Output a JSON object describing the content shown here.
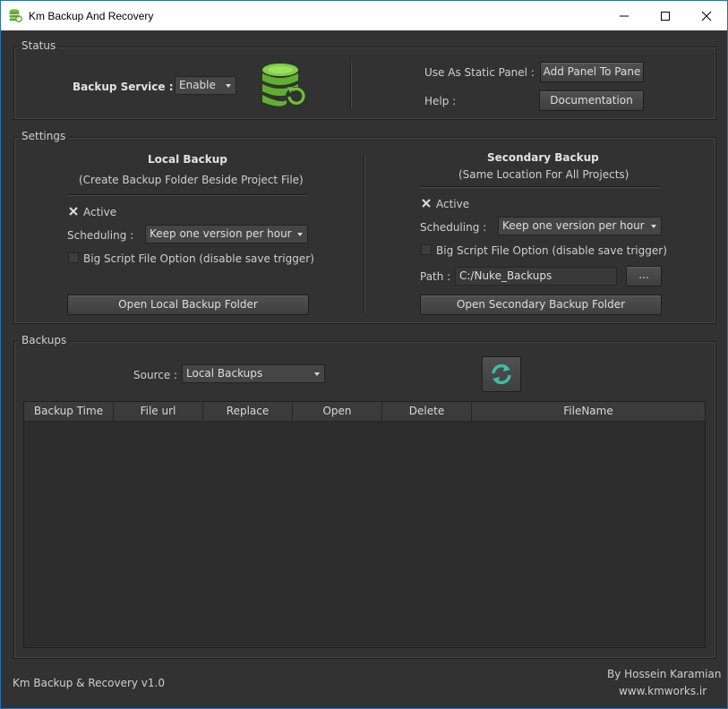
{
  "window": {
    "title": "Km Backup And Recovery",
    "controls": [
      "minimize",
      "maximize",
      "close"
    ]
  },
  "status": {
    "group_title": "Status",
    "backup_service_label": "Backup Service :",
    "backup_service_value": "Enable",
    "static_panel_label": "Use As Static Panel :",
    "add_panel_button": "Add Panel To Pane",
    "help_label": "Help :",
    "documentation_button": "Documentation",
    "logo_icon": "database-restore-icon"
  },
  "settings": {
    "group_title": "Settings",
    "local": {
      "title": "Local  Backup",
      "subtitle": "(Create Backup Folder Beside Project File)",
      "active_label": "Active",
      "active_checked": true,
      "scheduling_label": "Scheduling :",
      "scheduling_value": "Keep one version per hour",
      "big_script_label": "Big Script File Option (disable save trigger)",
      "big_script_checked": false,
      "open_folder_button": "Open Local Backup Folder"
    },
    "secondary": {
      "title": "Secondary Backup",
      "subtitle": "(Same Location For All Projects)",
      "active_label": "Active",
      "active_checked": true,
      "scheduling_label": "Scheduling :",
      "scheduling_value": "Keep one version per hour",
      "big_script_label": "Big Script File Option (disable save trigger)",
      "big_script_checked": false,
      "path_label": "Path :",
      "path_value": "C:/Nuke_Backups",
      "browse_button": "...",
      "open_folder_button": "Open Secondary Backup Folder"
    }
  },
  "backups": {
    "group_title": "Backups",
    "source_label": "Source :",
    "source_value": "Local Backups",
    "columns": [
      "Backup Time",
      "File url",
      "Replace",
      "Open",
      "Delete",
      "FileName"
    ],
    "rows": []
  },
  "footer": {
    "version": "Km Backup & Recovery v1.0",
    "author": "By Hossein Karamian",
    "website": "www.kmworks.ir"
  },
  "colors": {
    "background": "#323232",
    "accent_green": "#6fbf3a",
    "refresh_teal": "#3bbfa3",
    "titlebar": "#ffffff"
  }
}
